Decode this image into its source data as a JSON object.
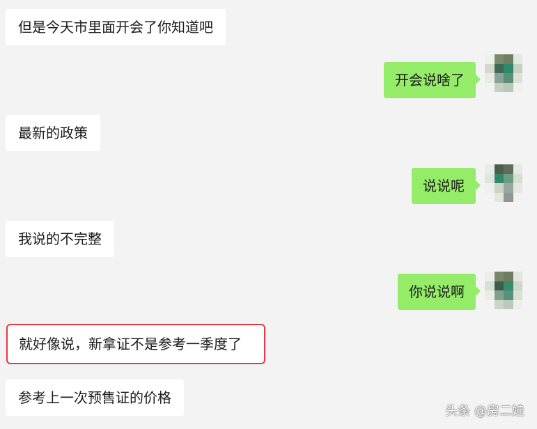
{
  "messages": [
    {
      "side": "left",
      "text": "但是今天市里面开会了你知道吧"
    },
    {
      "side": "right",
      "text": "开会说啥了"
    },
    {
      "side": "left",
      "text": "最新的政策"
    },
    {
      "side": "right",
      "text": "说说呢"
    },
    {
      "side": "left",
      "text": "我说的不完整"
    },
    {
      "side": "right",
      "text": "你说说啊"
    },
    {
      "side": "left",
      "text": "就好像说，新拿证不是参考一季度了",
      "highlighted": true
    },
    {
      "side": "left",
      "text": "参考上一次预售证的价格"
    }
  ],
  "avatar": {
    "icon": "pixelated-avatar-icon",
    "colors": [
      "#e9ece6",
      "#6b7a5c",
      "#2f8a6b",
      "#5d8f74",
      "#c9d3c2",
      "#3a5b4a",
      "#8fa59a",
      "#4a6a58"
    ]
  },
  "colors": {
    "bubble_right": "#95ec69",
    "bubble_left": "#ffffff",
    "highlight_border": "#e8383d",
    "background": "#f3f3f3"
  },
  "watermark": "头条 @房二娃"
}
